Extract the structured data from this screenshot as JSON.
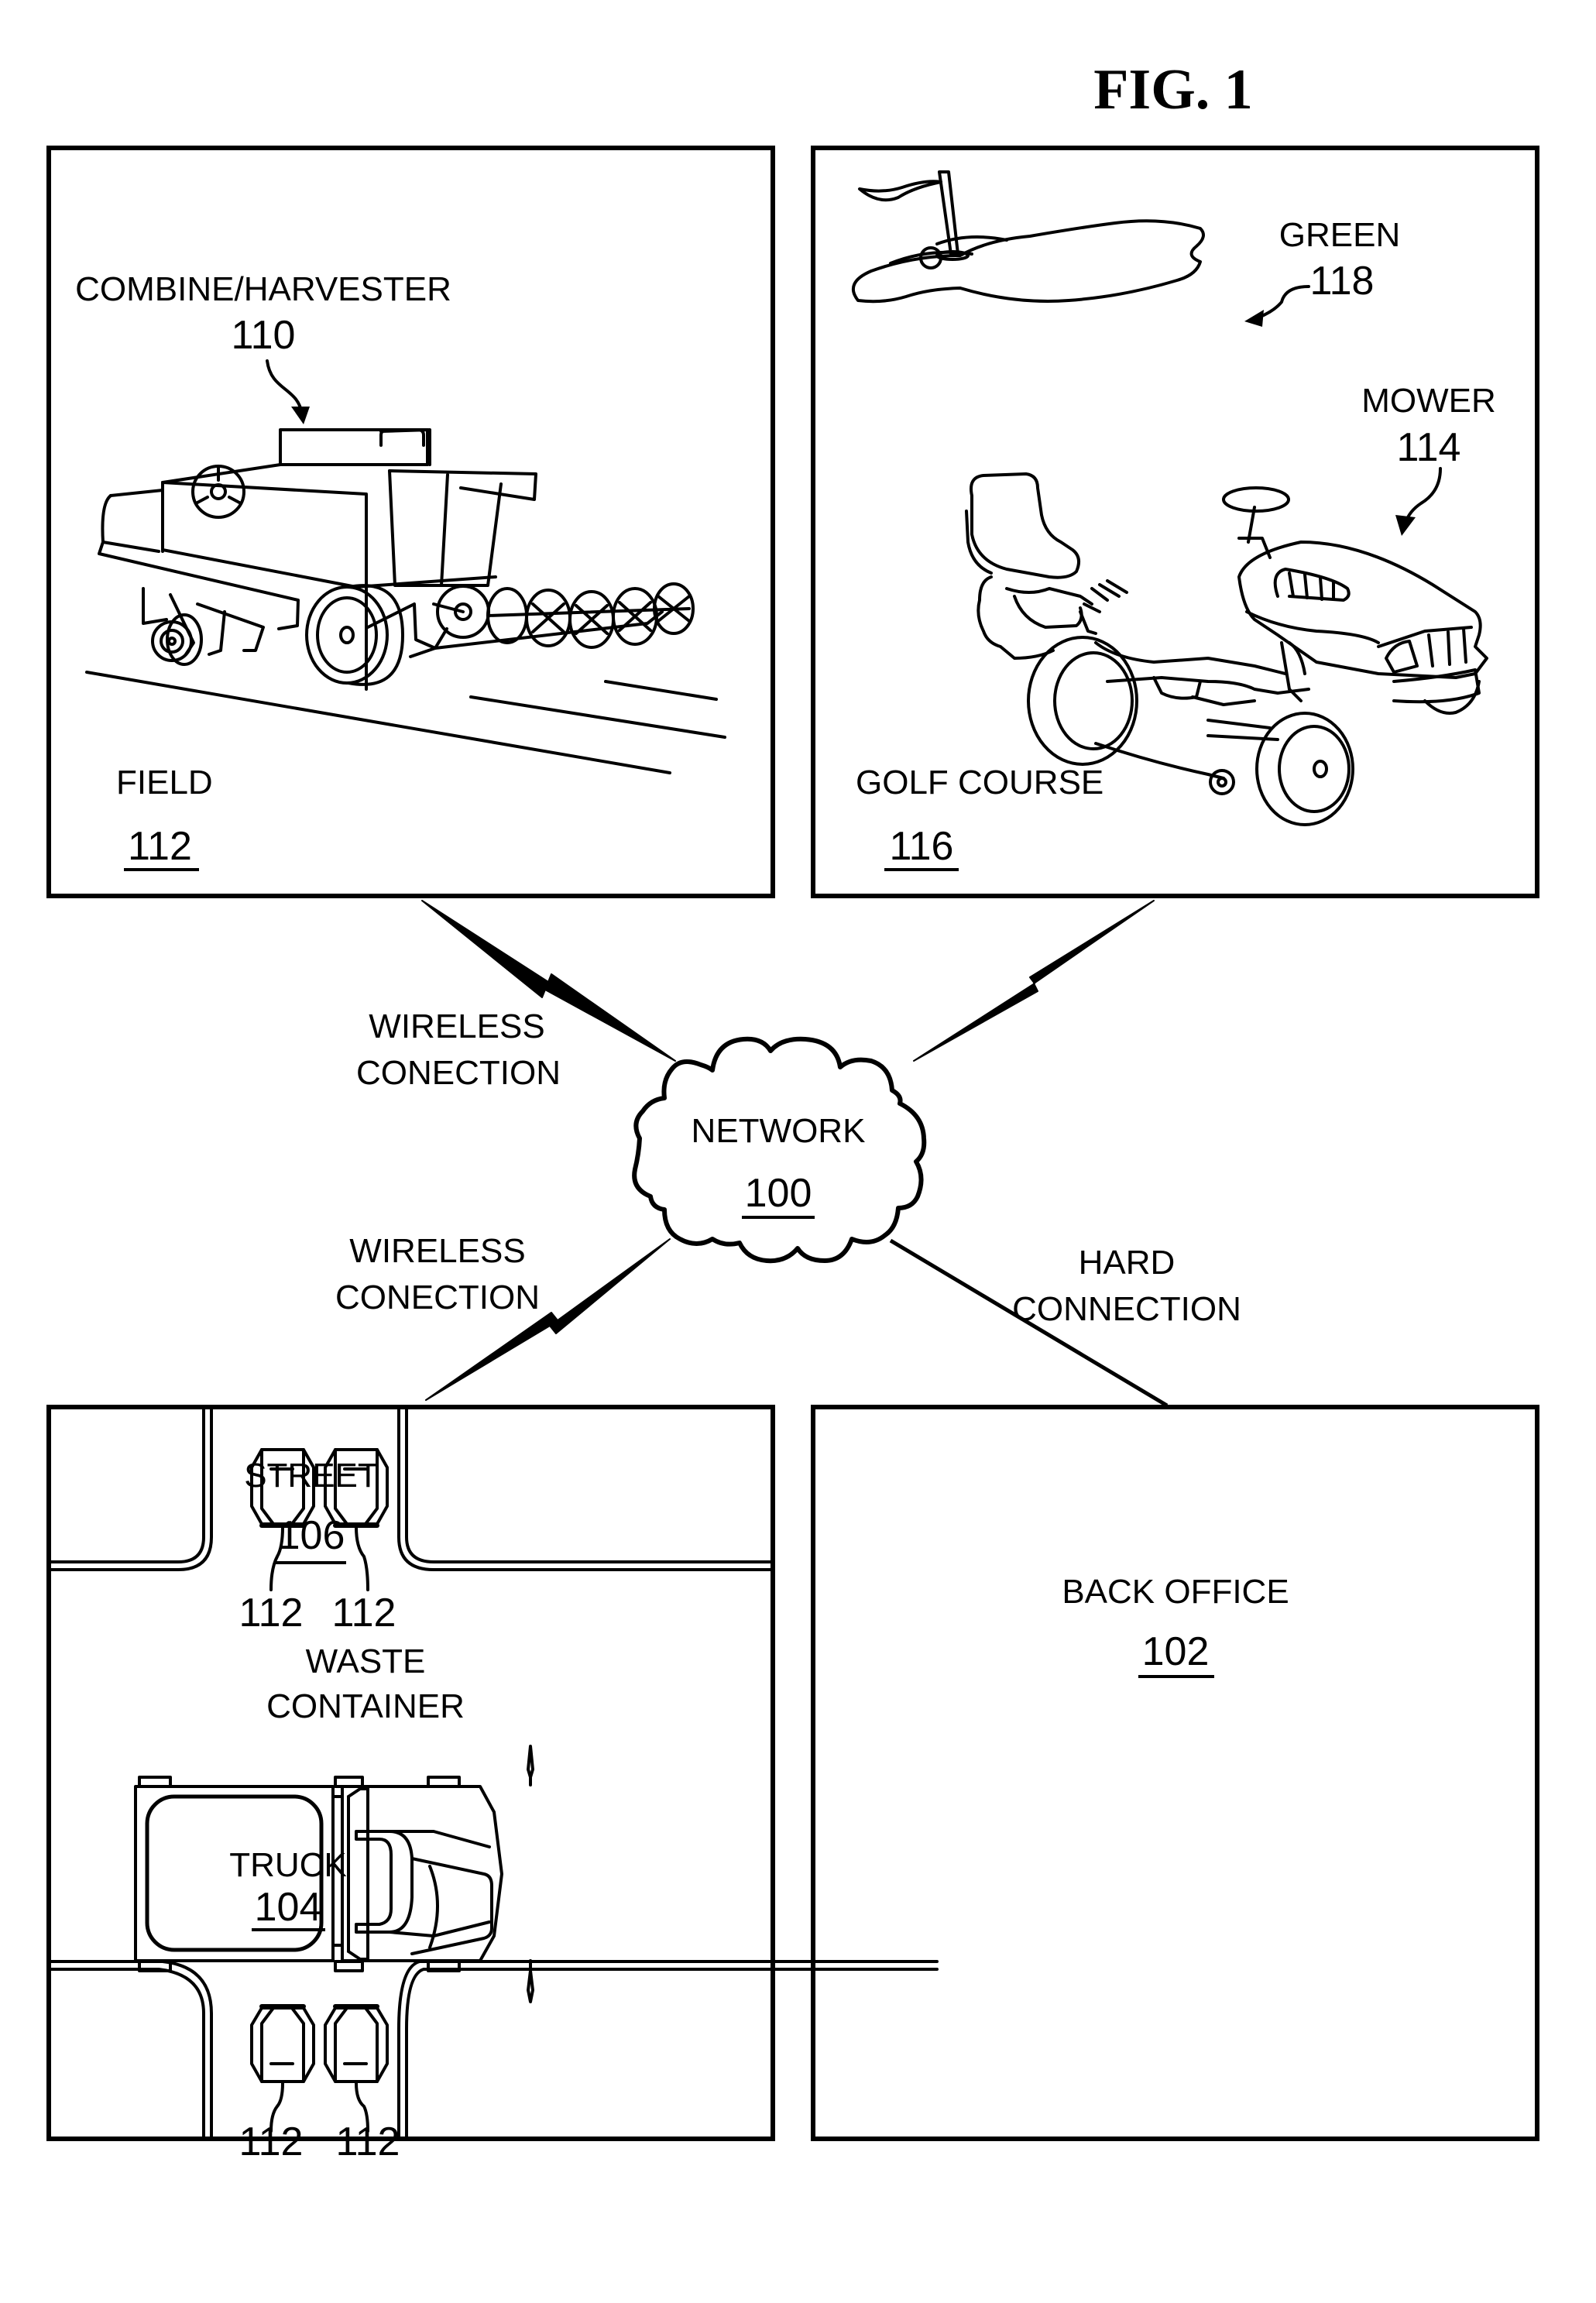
{
  "figure": {
    "title": "FIG. 1",
    "ink_color": "#000000",
    "background_color": "#ffffff"
  },
  "panels": {
    "field": {
      "vehicle_label": "COMBINE/HARVESTER",
      "vehicle_ref": "110",
      "area_label": "FIELD",
      "area_ref": "112"
    },
    "golf_course": {
      "green_label": "GREEN",
      "green_ref": "118",
      "mower_label": "MOWER",
      "mower_ref": "114",
      "area_label": "GOLF COURSE",
      "area_ref": "116"
    },
    "street": {
      "area_label": "STREET",
      "area_ref": "106",
      "truck_label": "TRUCK",
      "truck_ref": "104",
      "container_label_line1": "WASTE",
      "container_label_line2": "CONTAINER",
      "containers": [
        {
          "ref": "112"
        },
        {
          "ref": "112"
        },
        {
          "ref": "112"
        },
        {
          "ref": "112"
        }
      ]
    },
    "back_office": {
      "label": "BACK OFFICE",
      "ref": "102"
    }
  },
  "network": {
    "label": "NETWORK",
    "ref": "100"
  },
  "connections": {
    "top_left": {
      "line1": "WIRELESS",
      "line2": "CONECTION",
      "type": "wireless"
    },
    "top_right": {
      "type": "wireless"
    },
    "bottom_left": {
      "line1": "WIRELESS",
      "line2": "CONECTION",
      "type": "wireless"
    },
    "bottom_right": {
      "line1": "HARD",
      "line2": "CONNECTION",
      "type": "wired"
    }
  }
}
